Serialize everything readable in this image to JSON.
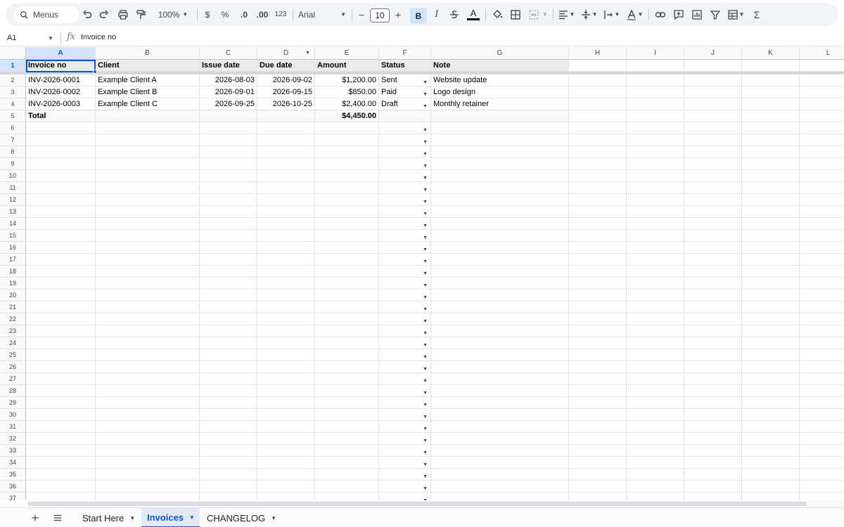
{
  "toolbar": {
    "menus_label": "Menus",
    "zoom": "100%",
    "currency": "$",
    "percent": "%",
    "decrease_decimals": ".0",
    "increase_decimals": ".00",
    "more_formats": "123",
    "font": "Arial",
    "font_size": "10",
    "minus": "−",
    "plus": "+",
    "bold": "B",
    "italic": "I",
    "text_color": "A",
    "sum_symbol": "Σ"
  },
  "formula_bar": {
    "name_box": "A1",
    "fx": "fx",
    "value": "Invoice no"
  },
  "columns": [
    "A",
    "B",
    "C",
    "D",
    "E",
    "F",
    "G",
    "H",
    "I",
    "J",
    "K",
    "L"
  ],
  "headers": [
    "Invoice no",
    "Client",
    "Issue date",
    "Due date",
    "Amount",
    "Status",
    "Note"
  ],
  "rows": [
    [
      "INV-2026-0001",
      "Example Client A",
      "2026-08-03",
      "2026-09-02",
      "$1,200.00",
      "Sent",
      "Website update"
    ],
    [
      "INV-2026-0002",
      "Example Client B",
      "2026-09-01",
      "2026-09-15",
      "$850.00",
      "Paid",
      "Logo design"
    ],
    [
      "INV-2026-0003",
      "Example Client C",
      "2026-09-25",
      "2026-10-25",
      "$2,400.00",
      "Draft",
      "Monthly retainer"
    ]
  ],
  "total_row": {
    "label": "Total",
    "amount": "$4,450.00"
  },
  "row_count": 37,
  "sheet_tabs": [
    {
      "label": "Start Here",
      "active": false
    },
    {
      "label": "Invoices",
      "active": true
    },
    {
      "label": "CHANGELOG",
      "active": false
    }
  ],
  "colors": {
    "accent": "#0b57d0",
    "selection_fill": "#d3e3fd",
    "header_fill": "#e8eaed"
  }
}
